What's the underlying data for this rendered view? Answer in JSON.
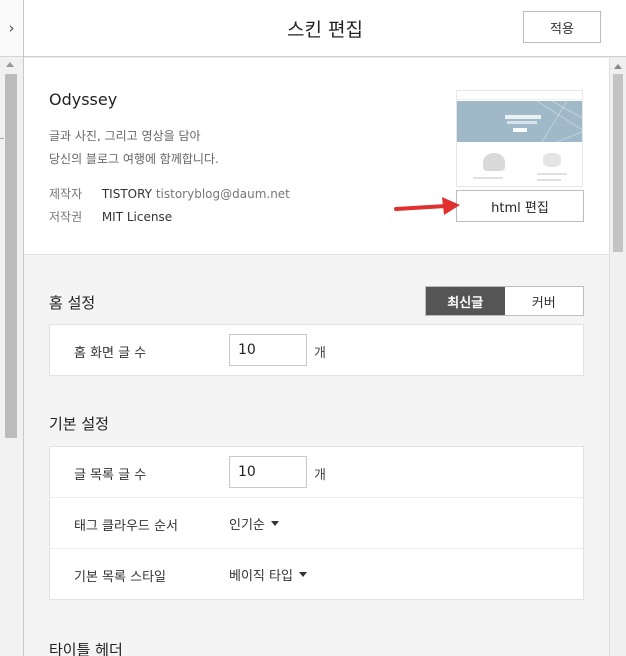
{
  "header": {
    "title": "스킨 편집",
    "apply_label": "적용"
  },
  "left_panel": {
    "collapse_glyph": "›"
  },
  "skin": {
    "name": "Odyssey",
    "description_lines": [
      "글과 사진, 그리고 영상을 담아",
      "당신의 블로그 여행에 함께합니다."
    ],
    "creator_label": "제작자",
    "creator_name": "TISTORY",
    "creator_email": "tistoryblog@daum.net",
    "license_label": "저작권",
    "license_value": "MIT License",
    "html_edit_label": "html 편집",
    "preview_icon": "skin-preview-thumbnail"
  },
  "home_settings": {
    "title": "홈 설정",
    "toggle": {
      "options": [
        "최신글",
        "커버"
      ],
      "selected": "최신글"
    },
    "rows": [
      {
        "label": "홈 화면 글 수",
        "value": "10",
        "unit": "개"
      }
    ]
  },
  "basic_settings": {
    "title": "기본 설정",
    "post_count": {
      "label": "글 목록 글 수",
      "value": "10",
      "unit": "개"
    },
    "tag_cloud": {
      "label": "태그 클라우드 순서",
      "value": "인기순"
    },
    "list_style": {
      "label": "기본 목록 스타일",
      "value": "베이직 타입"
    }
  },
  "title_header": {
    "title": "타이틀 헤더"
  },
  "colors": {
    "accent_arrow": "#e0312f",
    "toggle_active": "#555555"
  }
}
